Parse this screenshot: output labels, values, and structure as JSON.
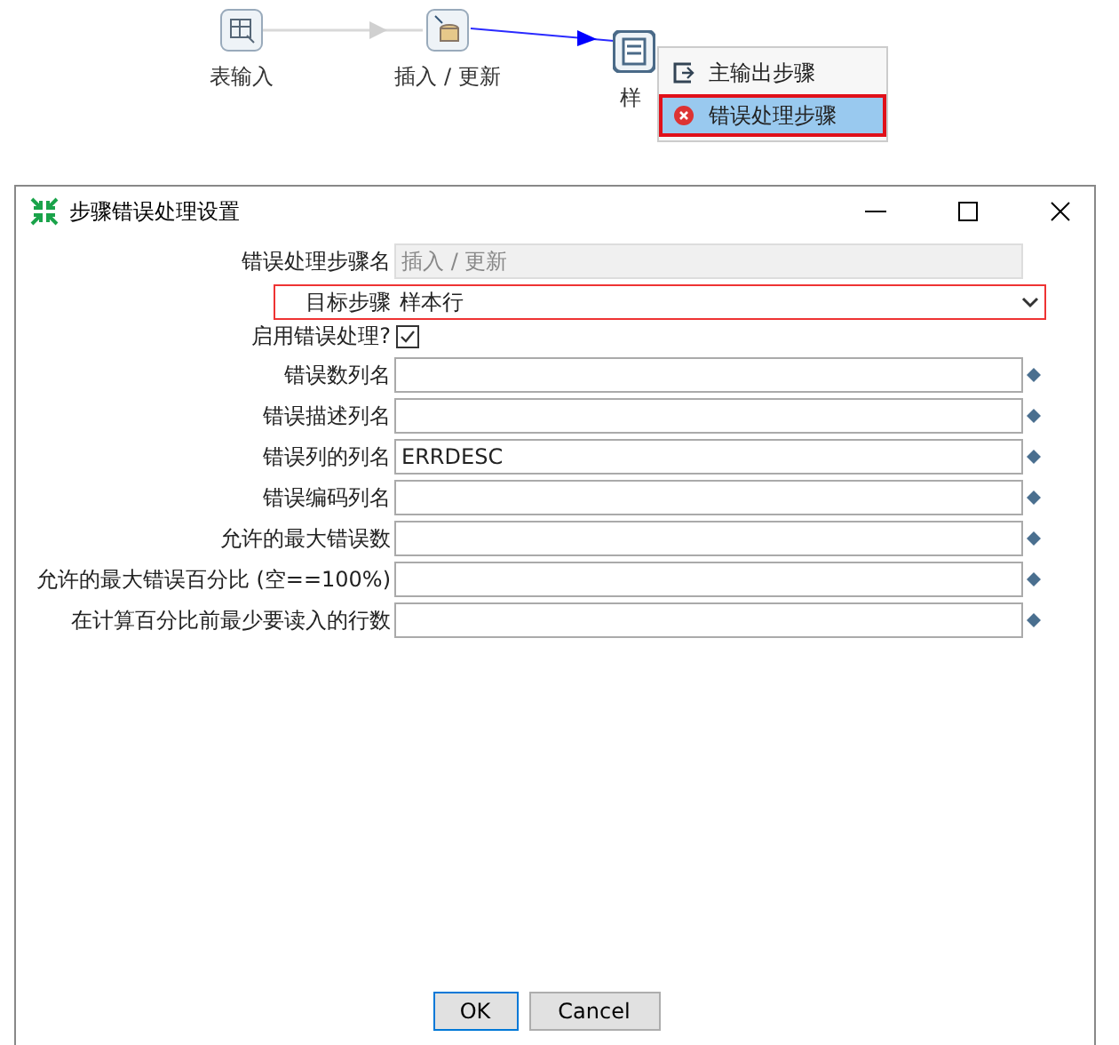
{
  "canvas": {
    "nodes": [
      {
        "label": "表输入",
        "kind": "table"
      },
      {
        "label": "插入 / 更新",
        "kind": "insert"
      },
      {
        "label": "样",
        "kind": "sample"
      }
    ],
    "context_menu": [
      {
        "label": "主输出步骤",
        "kind": "main",
        "selected": false,
        "highlighted": false
      },
      {
        "label": "错误处理步骤",
        "kind": "error",
        "selected": true,
        "highlighted": true
      }
    ]
  },
  "dialog": {
    "title": "步骤错误处理设置",
    "rows": [
      {
        "kind": "readonly",
        "label": "错误处理步骤名",
        "value": "插入 / 更新"
      },
      {
        "kind": "combo",
        "label": "目标步骤",
        "value": "样本行",
        "highlighted": true
      },
      {
        "kind": "checkbox",
        "label": "启用错误处理?",
        "checked": true
      },
      {
        "kind": "field",
        "label": "错误数列名"
      },
      {
        "kind": "field",
        "label": "错误描述列名"
      },
      {
        "kind": "field",
        "label": "错误列的列名",
        "value": "ERRDESC"
      },
      {
        "kind": "field",
        "label": "错误编码列名"
      },
      {
        "kind": "field",
        "label": "允许的最大错误数"
      },
      {
        "kind": "field",
        "label": "允许的最大错误百分比 (空==100%)"
      },
      {
        "kind": "field",
        "label": "在计算百分比前最少要读入的行数"
      }
    ],
    "buttons": [
      {
        "label": "OK",
        "default": true
      },
      {
        "label": "Cancel",
        "default": false
      }
    ]
  }
}
